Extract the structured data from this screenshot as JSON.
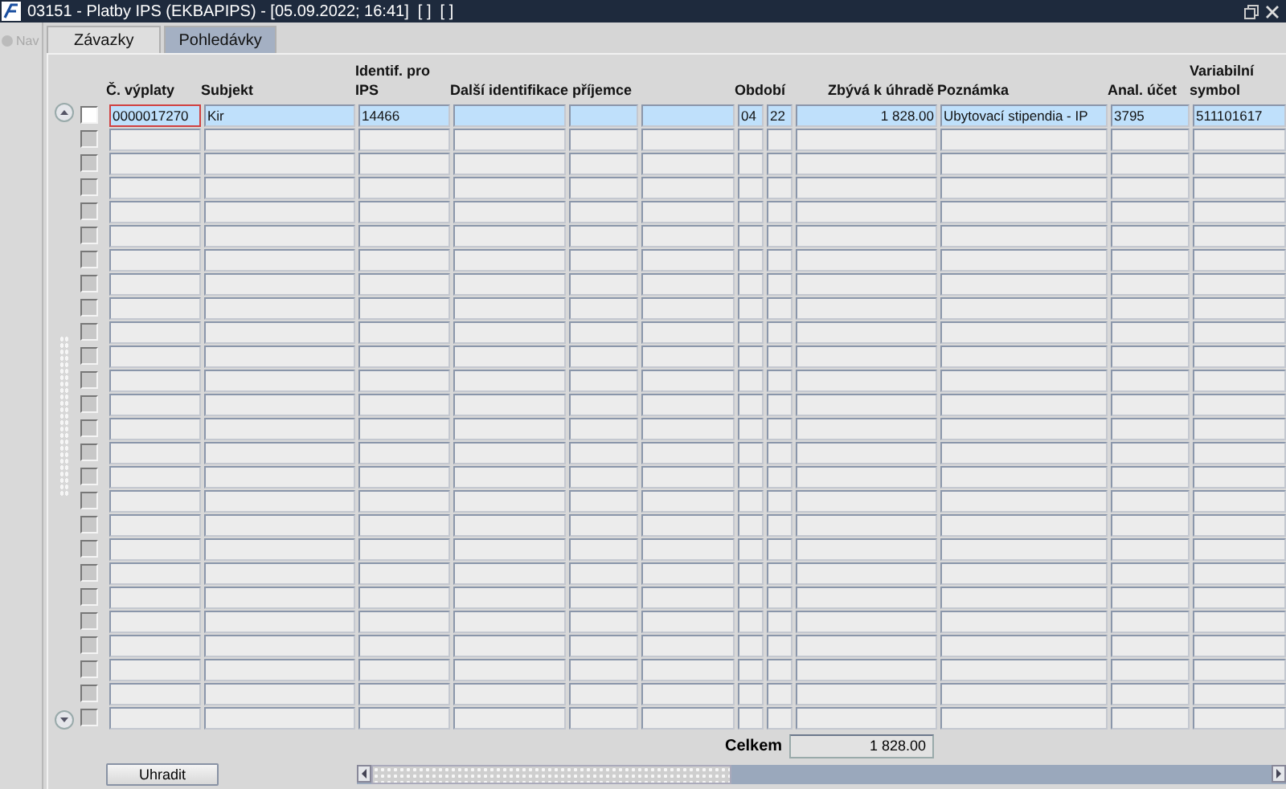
{
  "window": {
    "title": "03151 - Platby IPS (EKBAPIPS) - [05.09.2022; 16:41]  [ ]  [ ]"
  },
  "nav": {
    "label": "Nav",
    "disabled": true
  },
  "tabs": [
    {
      "label": "Závazky",
      "selected": true
    },
    {
      "label": "Pohledávky",
      "selected": false
    }
  ],
  "table": {
    "headers": [
      "Č. výplaty",
      "Subjekt",
      "Identif. pro IPS",
      "Další identifikace příjemce",
      "Období",
      "Zbývá k úhradě",
      "Poznámka",
      "Anal. účet",
      "Variabilní symbol"
    ],
    "rows": [
      {
        "selected": true,
        "checked": false,
        "cislo": {
          "text": "0000017270",
          "focused": true
        },
        "subjekt": "Kir",
        "ips": "14466",
        "obdobi_mesic": "04",
        "obdobi_rok": "22",
        "zbyva": "1 828.00",
        "poznamka": "Ubytovací stipendia - IP",
        "anal": "3795",
        "vs": "511101617"
      },
      {
        "selected": false,
        "checked": false
      },
      {
        "selected": false,
        "checked": false
      },
      {
        "selected": false,
        "checked": false
      },
      {
        "selected": false,
        "checked": false
      },
      {
        "selected": false,
        "checked": false
      },
      {
        "selected": false,
        "checked": false
      },
      {
        "selected": false,
        "checked": false
      },
      {
        "selected": false,
        "checked": false
      },
      {
        "selected": false,
        "checked": false
      },
      {
        "selected": false,
        "checked": false
      },
      {
        "selected": false,
        "checked": false
      },
      {
        "selected": false,
        "checked": false
      },
      {
        "selected": false,
        "checked": false
      },
      {
        "selected": false,
        "checked": false
      },
      {
        "selected": false,
        "checked": false
      },
      {
        "selected": false,
        "checked": false
      },
      {
        "selected": false,
        "checked": false
      },
      {
        "selected": false,
        "checked": false
      },
      {
        "selected": false,
        "checked": false
      },
      {
        "selected": false,
        "checked": false
      },
      {
        "selected": false,
        "checked": false
      },
      {
        "selected": false,
        "checked": false
      },
      {
        "selected": false,
        "checked": false
      },
      {
        "selected": false,
        "checked": false
      },
      {
        "selected": false,
        "checked": false
      }
    ]
  },
  "total": {
    "label": "Celkem",
    "value": "1 828.00"
  },
  "buttons": [
    {
      "label": "Uhradit"
    }
  ]
}
